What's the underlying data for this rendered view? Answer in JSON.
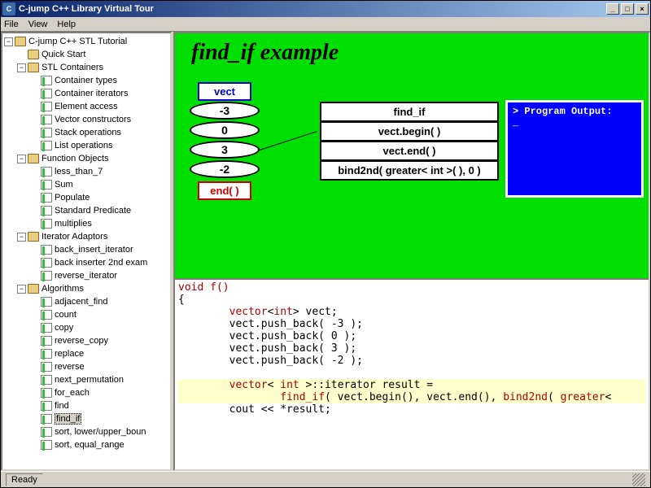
{
  "window": {
    "title": "C-jump C++ Library Virtual Tour"
  },
  "menu": {
    "file": "File",
    "view": "View",
    "help": "Help"
  },
  "tree": {
    "root": "C-jump C++ STL Tutorial",
    "quickstart": "Quick Start",
    "containers": {
      "label": "STL Containers",
      "items": [
        "Container types",
        "Container iterators",
        "Element access",
        "Vector constructors",
        "Stack operations",
        "List operations"
      ]
    },
    "funcobj": {
      "label": "Function Objects",
      "items": [
        "less_than_7",
        "Sum",
        "Populate",
        "Standard Predicate",
        "multiplies"
      ]
    },
    "iteradapt": {
      "label": "Iterator Adaptors",
      "items": [
        "back_insert_iterator",
        "back inserter 2nd exam",
        "reverse_iterator"
      ]
    },
    "algos": {
      "label": "Algorithms",
      "items": [
        "adjacent_find",
        "count",
        "copy",
        "reverse_copy",
        "replace",
        "reverse",
        "next_permutation",
        "for_each",
        "find",
        "find_if",
        "sort, lower/upper_boun",
        "sort, equal_range"
      ]
    },
    "selected": "find_if"
  },
  "diagram": {
    "title": "find_if example",
    "vect_label": "vect",
    "values": [
      "-3",
      "0",
      "3",
      "-2"
    ],
    "end_label": "end( )",
    "call": {
      "name": "find_if",
      "arg1": "vect.begin( )",
      "arg2": "vect.end( )",
      "arg3": "bind2nd( greater< int >( ), 0 )"
    },
    "output_title": "> Program Output:",
    "output_cursor": "_"
  },
  "code": {
    "l1": "void f()",
    "l2": "{",
    "l3a": "        ",
    "l3b": "vector",
    "l3c": "<",
    "l3d": "int",
    "l3e": "> vect;",
    "l4": "        vect.push_back( -3 );",
    "l5": "        vect.push_back( 0 );",
    "l6": "        vect.push_back( 3 );",
    "l7": "        vect.push_back( -2 );",
    "l8": " ",
    "h1a": "        ",
    "h1b": "vector",
    "h1c": "< ",
    "h1d": "int",
    "h1e": " >::iterator result =",
    "h2a": "                ",
    "h2b": "find_if",
    "h2c": "( vect.begin(), vect.end(), ",
    "h2d": "bind2nd",
    "h2e": "( ",
    "h2f": "greater",
    "h2g": "<",
    "l9": "        cout << *result;"
  },
  "status": {
    "text": "Ready"
  }
}
